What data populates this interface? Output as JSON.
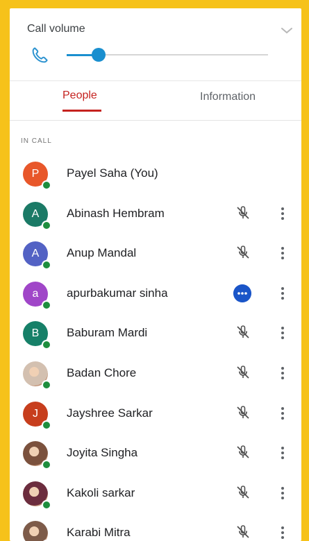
{
  "volume": {
    "title": "Call volume",
    "level": 0.16
  },
  "tabs": [
    {
      "label": "People",
      "active": true
    },
    {
      "label": "Information",
      "active": false
    }
  ],
  "section_label": "IN CALL",
  "colors": {
    "active_tab": "#c5221f",
    "slider": "#1a8fcf",
    "online": "#1e8e3e"
  },
  "participants": [
    {
      "name": "Payel Saha (You)",
      "initial": "P",
      "color": "#e8572a",
      "photo": false,
      "status": "none"
    },
    {
      "name": "Abinash Hembram",
      "initial": "A",
      "color": "#1b7a66",
      "photo": false,
      "status": "muted"
    },
    {
      "name": "Anup Mandal",
      "initial": "A",
      "color": "#5362c4",
      "photo": false,
      "status": "muted"
    },
    {
      "name": "apurbakumar sinha",
      "initial": "a",
      "color": "#a046c8",
      "photo": false,
      "status": "more"
    },
    {
      "name": "Baburam Mardi",
      "initial": "B",
      "color": "#168068",
      "photo": false,
      "status": "muted"
    },
    {
      "name": "Badan Chore",
      "initial": "",
      "color": "#d3c0b0",
      "photo": true,
      "status": "muted"
    },
    {
      "name": "Jayshree Sarkar",
      "initial": "J",
      "color": "#c73e1d",
      "photo": false,
      "status": "muted"
    },
    {
      "name": "Joyita Singha",
      "initial": "",
      "color": "#7b513d",
      "photo": true,
      "status": "muted"
    },
    {
      "name": "Kakoli sarkar",
      "initial": "",
      "color": "#6c2d3e",
      "photo": true,
      "status": "muted"
    },
    {
      "name": "Karabi Mitra",
      "initial": "",
      "color": "#7d5b49",
      "photo": true,
      "status": "muted"
    }
  ]
}
